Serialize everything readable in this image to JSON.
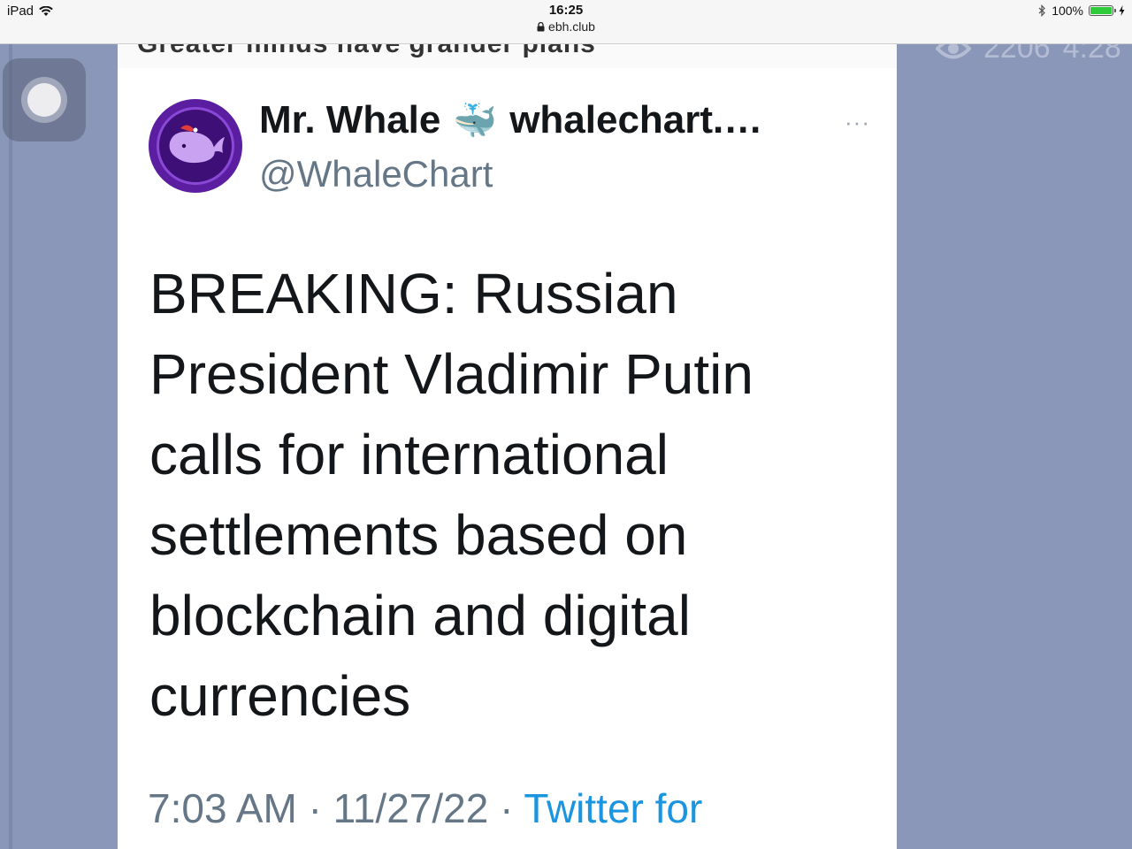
{
  "status_bar": {
    "device": "iPad",
    "time": "16:25",
    "url": "ebh.club",
    "battery": "100%",
    "wifi_icon": "wifi-icon",
    "lock_icon": "lock-icon",
    "bluetooth_icon": "bluetooth-icon"
  },
  "previous_message": {
    "caption": "Greater minds have grander plans",
    "views": "2206",
    "time": "4:28"
  },
  "tweet": {
    "display_name": "Mr. Whale",
    "emoji": "🐳",
    "name_suffix": "whalechart.…",
    "handle": "@WhaleChart",
    "more_label": "···",
    "text": "BREAKING: Russian President Vladimir Putin calls for international settlements based on blockchain and digital currencies",
    "time": "7:03 AM",
    "separator": "·",
    "date": "11/27/22",
    "source": "Twitter for"
  },
  "colors": {
    "page_background": "#8b97b9",
    "card_background": "#ffffff",
    "link_blue": "#1b95e0",
    "muted_gray": "#657786"
  }
}
